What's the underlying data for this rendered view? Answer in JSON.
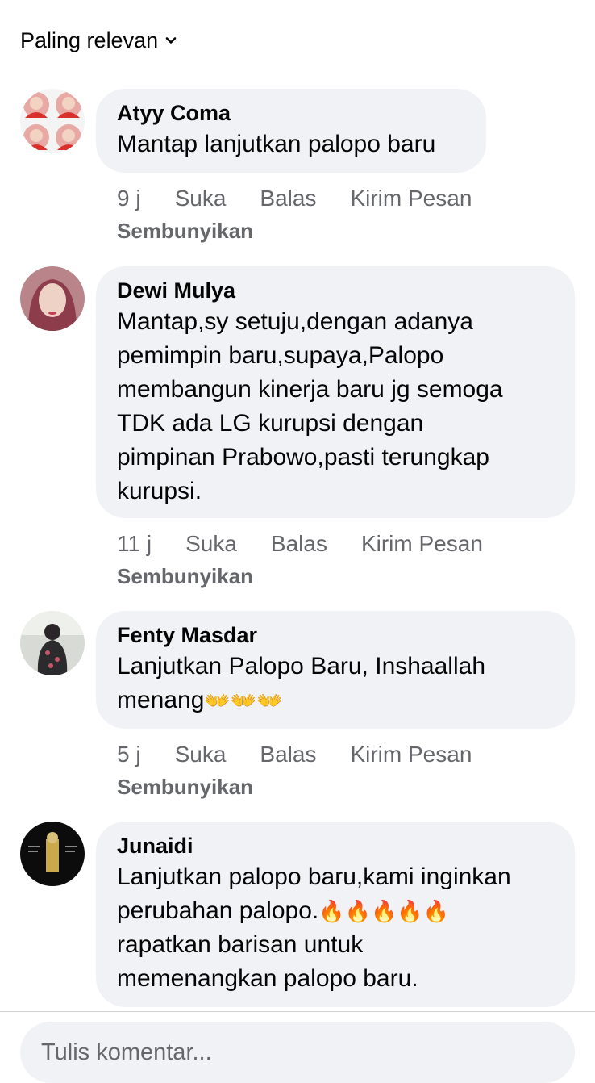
{
  "sort": {
    "label": "Paling relevan"
  },
  "comments": [
    {
      "author": "Atyy Coma",
      "text": "Mantap lanjutkan palopo baru",
      "time": "9 j",
      "like": "Suka",
      "reply": "Balas",
      "message": "Kirim Pesan",
      "hide": "Sembunyikan"
    },
    {
      "author": "Dewi Mulya",
      "text": "Mantap,sy setuju,dengan adanya\npemimpin baru,supaya,Palopo\nmembangun kinerja baru jg semoga\nTDK ada LG kurupsi dengan\npimpinan Prabowo,pasti terungkap\nkurupsi.",
      "time": "11 j",
      "like": "Suka",
      "reply": "Balas",
      "message": "Kirim Pesan",
      "hide": "Sembunyikan"
    },
    {
      "author": "Fenty Masdar",
      "text": "Lanjutkan Palopo Baru, Inshaallah\nmenang",
      "emoji": "👐👐👐",
      "time": "5 j",
      "like": "Suka",
      "reply": "Balas",
      "message": "Kirim Pesan",
      "hide": "Sembunyikan"
    },
    {
      "author": "Junaidi",
      "text_before": "Lanjutkan palopo baru,kami inginkan\nperubahan palopo.",
      "emoji": "🔥🔥🔥🔥🔥",
      "text_after": "\nrapatkan barisan untuk\nmemenangkan palopo baru."
    }
  ],
  "composer": {
    "placeholder": "Tulis komentar..."
  },
  "colors": {
    "bubble": "#f0f2f5",
    "secondary_text": "#65676b",
    "primary_text": "#050505"
  }
}
